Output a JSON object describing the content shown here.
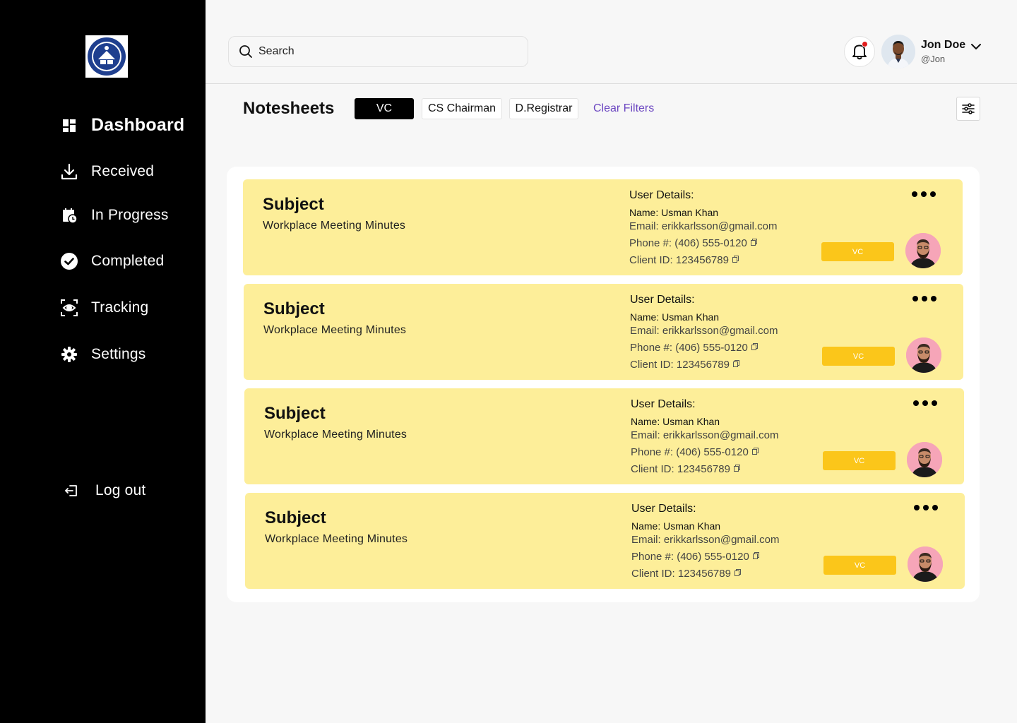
{
  "sidebar": {
    "logo_icon": "university-seal-icon",
    "items": [
      {
        "label": "Dashboard",
        "icon": "dashboard-grid-icon",
        "active": true
      },
      {
        "label": "Received",
        "icon": "download-tray-icon"
      },
      {
        "label": "In Progress",
        "icon": "calendar-clock-icon"
      },
      {
        "label": "Completed",
        "icon": "check-circle-icon"
      },
      {
        "label": "Tracking",
        "icon": "eye-scan-icon"
      },
      {
        "label": "Settings",
        "icon": "gear-icon"
      }
    ],
    "logout_label": "Log out"
  },
  "header": {
    "search_placeholder": "Search",
    "user_name": "Jon Doe",
    "user_handle": "@Jon",
    "notification_dot_color": "#e11d1d"
  },
  "toolbar": {
    "title": "Notesheets",
    "chips": [
      {
        "label": "VC",
        "active": true
      },
      {
        "label": "CS Chairman",
        "active": false
      },
      {
        "label": "D.Registrar",
        "active": false
      }
    ],
    "clear_filters": "Clear Filters"
  },
  "colors": {
    "sidebar_bg": "#000000",
    "card_bg": "#fdee99",
    "tag_bg": "#fbc61a",
    "link": "#6b46c1"
  },
  "cards": [
    {
      "subject": "Subject",
      "topic": "Workplace Meeting Minutes",
      "details_title": "User Details:",
      "name": "Name: Usman Khan",
      "email": "Email: erikkarlsson@gmail.com",
      "phone": "Phone #: (406) 555-0120",
      "client_id": "Client ID: 123456789",
      "tag": "VC"
    },
    {
      "subject": "Subject",
      "topic": "Workplace Meeting Minutes",
      "details_title": "User Details:",
      "name": "Name: Usman Khan",
      "email": "Email: erikkarlsson@gmail.com",
      "phone": "Phone #: (406) 555-0120",
      "client_id": "Client ID: 123456789",
      "tag": "VC"
    },
    {
      "subject": "Subject",
      "topic": "Workplace Meeting Minutes",
      "details_title": "User Details:",
      "name": "Name: Usman Khan",
      "email": "Email: erikkarlsson@gmail.com",
      "phone": "Phone #: (406) 555-0120",
      "client_id": "Client ID: 123456789",
      "tag": "VC"
    },
    {
      "subject": "Subject",
      "topic": "Workplace Meeting Minutes",
      "details_title": "User Details:",
      "name": "Name: Usman Khan",
      "email": "Email: erikkarlsson@gmail.com",
      "phone": "Phone #: (406) 555-0120",
      "client_id": "Client ID: 123456789",
      "tag": "VC"
    }
  ]
}
